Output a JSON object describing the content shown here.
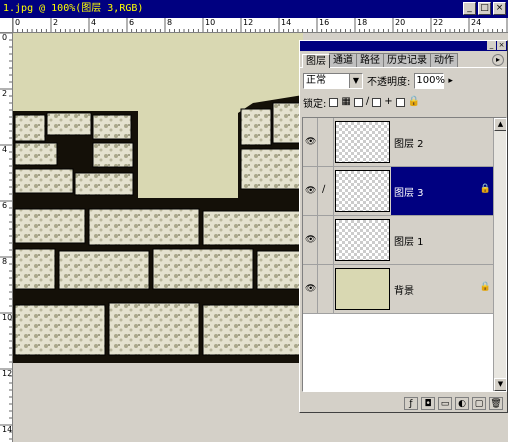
{
  "document": {
    "title": "1.jpg @ 100%(图层 3,RGB)",
    "min_button": "_",
    "max_button": "□",
    "close_button": "×",
    "ruler_h_labels": [
      "0",
      "2",
      "4",
      "6",
      "8",
      "10",
      "12",
      "14",
      "16",
      "18",
      "20",
      "22",
      "24"
    ],
    "ruler_v_labels": [
      "0",
      "2",
      "4",
      "6",
      "8",
      "10",
      "12",
      "14"
    ],
    "canvas_color": "#d9d8b2"
  },
  "layers_palette": {
    "tabs": [
      {
        "label": "图层",
        "active": true
      },
      {
        "label": "通道",
        "active": false
      },
      {
        "label": "路径",
        "active": false
      },
      {
        "label": "历史记录",
        "active": false
      },
      {
        "label": "动作",
        "active": false
      }
    ],
    "menu_icon": "▸",
    "blend_mode": "正常",
    "opacity_label": "不透明度:",
    "opacity_value": "100%",
    "opacity_arrow": "▸",
    "lock_label": "锁定:",
    "layers": [
      {
        "name": "图层 2",
        "visible": true,
        "selected": false,
        "locked": false
      },
      {
        "name": "图层 3",
        "visible": true,
        "selected": true,
        "locked": true
      },
      {
        "name": "图层 1",
        "visible": true,
        "selected": false,
        "locked": false
      },
      {
        "name": "背景",
        "visible": true,
        "selected": false,
        "locked": true
      }
    ],
    "selection_color": "#000080"
  },
  "icons": {
    "eye": "👁",
    "brush": "🖌",
    "lock": "🔒",
    "scroll_up": "▲",
    "scroll_down": "▼"
  }
}
